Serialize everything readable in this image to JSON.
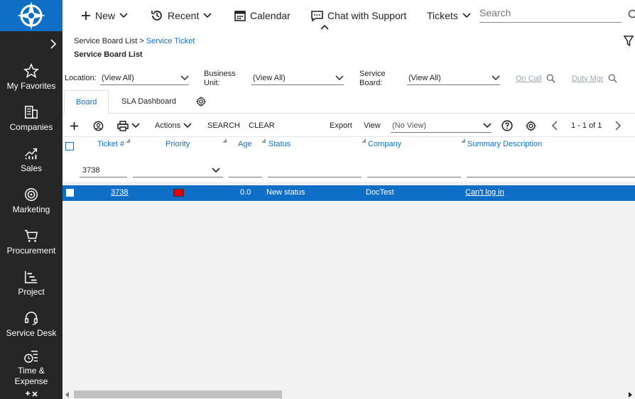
{
  "sidebar": {
    "items": [
      {
        "label": "My Favorites",
        "icon": "star-icon"
      },
      {
        "label": "Companies",
        "icon": "building-icon"
      },
      {
        "label": "Sales",
        "icon": "chart-growth-icon"
      },
      {
        "label": "Marketing",
        "icon": "target-icon"
      },
      {
        "label": "Procurement",
        "icon": "cart-icon"
      },
      {
        "label": "Project",
        "icon": "gantt-icon"
      },
      {
        "label": "Service Desk",
        "icon": "headset-icon"
      },
      {
        "label": "Time & Expense",
        "icon": "clock-list-icon"
      }
    ]
  },
  "topbar": {
    "new_label": "New",
    "recent_label": "Recent",
    "calendar_label": "Calendar",
    "chat_label": "Chat with Support",
    "tickets_label": "Tickets",
    "search_placeholder": "Search"
  },
  "breadcrumb": {
    "parent": "Service Board List",
    "current": "Service Ticket"
  },
  "page_title": "Service Board List",
  "filters": {
    "location_label": "Location:",
    "location_value": "(View All)",
    "business_unit_label_1": "Business",
    "business_unit_label_2": "Unit:",
    "business_unit_value": "(View All)",
    "service_board_label_1": "Service",
    "service_board_label_2": "Board:",
    "service_board_value": "(View All)",
    "on_call": "On Call",
    "duty_mgr": "Duty Mgr"
  },
  "tabs": [
    {
      "label": "Board",
      "active": true
    },
    {
      "label": "SLA Dashboard",
      "active": false
    }
  ],
  "toolbar": {
    "actions_label": "Actions",
    "search_label": "SEARCH",
    "clear_label": "CLEAR",
    "export_label": "Export",
    "view_label": "View",
    "view_value": "(No View)",
    "pagination": "1 - 1 of 1"
  },
  "columns": [
    "Ticket #",
    "Priority",
    "Age",
    "Status",
    "Company",
    "Summary Description"
  ],
  "column_filter": {
    "ticket": "3738"
  },
  "rows": [
    {
      "ticket": "3738",
      "priority_color": "#e00000",
      "age": "0.0",
      "status": "New status",
      "company": "DocTest",
      "summary": "Can't log in"
    }
  ],
  "colors": {
    "accent": "#0f6fc6",
    "sidebar": "#262626",
    "priority_high": "#e00000"
  }
}
